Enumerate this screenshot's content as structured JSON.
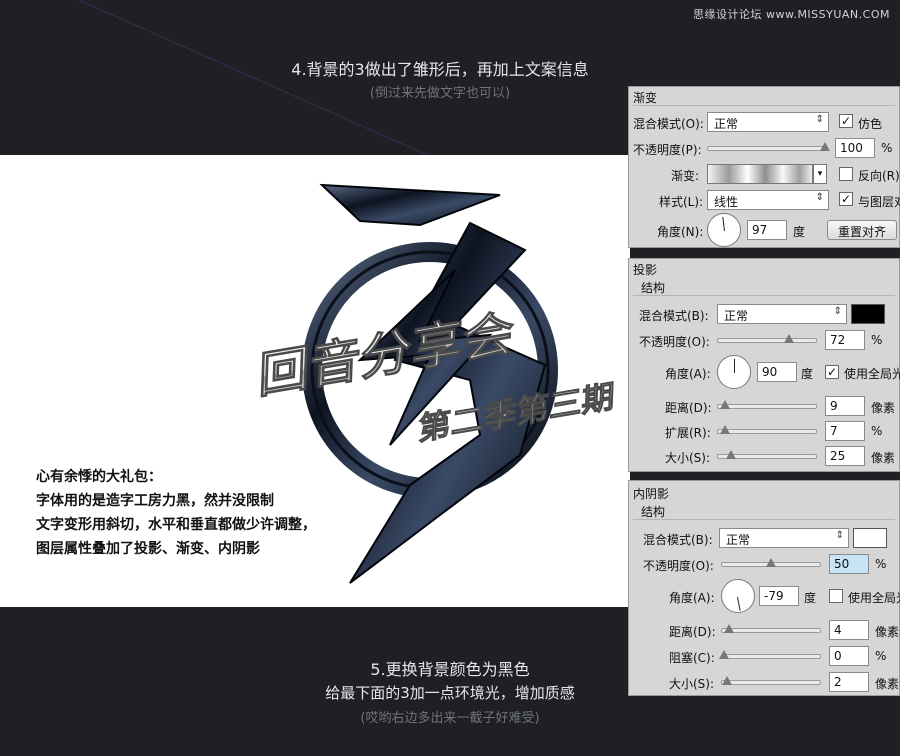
{
  "watermark": "思缘设计论坛 www.MISSYUAN.COM",
  "captions": {
    "step4_title": "4.背景的3做出了雏形后，再加上文案信息",
    "step4_sub": "(倒过来先做文字也可以)",
    "step5_title": "5.更换背景颜色为黑色",
    "step5_line2": "给最下面的3加一点环境光，增加质感",
    "step5_sub": "(哎哟右边多出来一截子好难受)"
  },
  "artwork": {
    "main_text": "回音分享会",
    "sub_text": "第二季第三期"
  },
  "notes": [
    "心有余悸的大礼包：",
    "字体用的是造字工房力黑，然并没限制",
    "文字变形用斜切，水平和垂直都做少许调整，",
    "图层属性叠加了投影、渐变、内阴影"
  ],
  "gradient_panel": {
    "title": "渐变",
    "blend_label": "混合模式(O):",
    "blend_value": "正常",
    "dither_label": "仿色",
    "dither_checked": "✓",
    "opacity_label": "不透明度(P):",
    "opacity_value": "100",
    "opacity_unit": "%",
    "gradient_label": "渐变:",
    "reverse_label": "反向(R)",
    "style_label": "样式(L):",
    "style_value": "线性",
    "align_label": "与图层对齐",
    "align_checked": "✓",
    "angle_label": "角度(N):",
    "angle_value": "97",
    "angle_unit": "度",
    "reset_button": "重置对齐"
  },
  "drop_shadow_panel": {
    "title": "投影",
    "structure": "结构",
    "blend_label": "混合模式(B):",
    "blend_value": "正常",
    "swatch_color": "#000000",
    "opacity_label": "不透明度(O):",
    "opacity_value": "72",
    "opacity_unit": "%",
    "angle_label": "角度(A):",
    "angle_value": "90",
    "angle_unit": "度",
    "global_light_label": "使用全局光",
    "global_light_checked": "✓",
    "distance_label": "距离(D):",
    "distance_value": "9",
    "distance_unit": "像素",
    "spread_label": "扩展(R):",
    "spread_value": "7",
    "spread_unit": "%",
    "size_label": "大小(S):",
    "size_value": "25",
    "size_unit": "像素"
  },
  "inner_shadow_panel": {
    "title": "内阴影",
    "structure": "结构",
    "blend_label": "混合模式(B):",
    "blend_value": "正常",
    "swatch_color": "#ffffff",
    "opacity_label": "不透明度(O):",
    "opacity_value": "50",
    "opacity_unit": "%",
    "angle_label": "角度(A):",
    "angle_value": "-79",
    "angle_unit": "度",
    "global_light_label": "使用全局光",
    "global_light_checked": "",
    "distance_label": "距离(D):",
    "distance_value": "4",
    "distance_unit": "像素",
    "choke_label": "阻塞(C):",
    "choke_value": "0",
    "choke_unit": "%",
    "size_label": "大小(S):",
    "size_value": "2",
    "size_unit": "像素"
  }
}
